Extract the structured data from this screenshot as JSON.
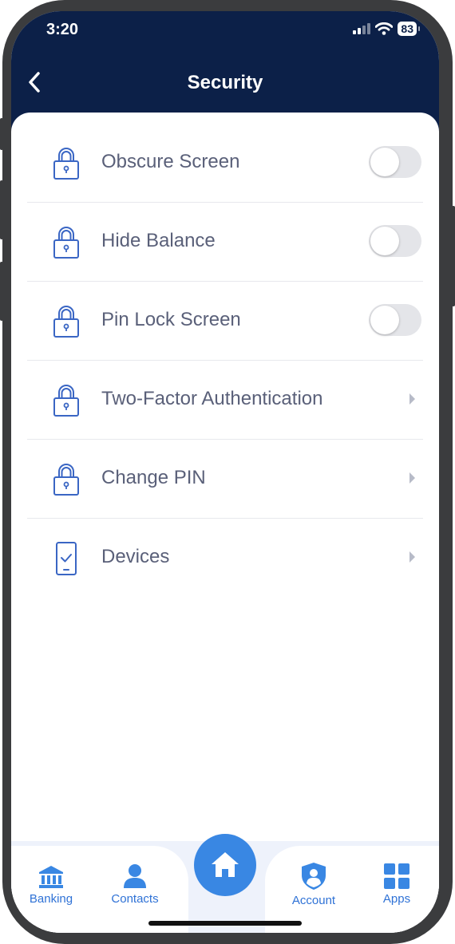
{
  "status_bar": {
    "time": "3:20",
    "battery": "83"
  },
  "header": {
    "title": "Security"
  },
  "settings": [
    {
      "label": "Obscure Screen",
      "icon": "lock-icon",
      "control": "toggle",
      "enabled": false
    },
    {
      "label": "Hide Balance",
      "icon": "lock-icon",
      "control": "toggle",
      "enabled": false
    },
    {
      "label": "Pin Lock Screen",
      "icon": "lock-icon",
      "control": "toggle",
      "enabled": false
    },
    {
      "label": "Two-Factor Authentication",
      "icon": "lock-icon",
      "control": "chevron"
    },
    {
      "label": "Change PIN",
      "icon": "lock-icon",
      "control": "chevron"
    },
    {
      "label": "Devices",
      "icon": "phone-icon",
      "control": "chevron"
    }
  ],
  "tabbar": {
    "items": [
      {
        "label": "Banking",
        "icon": "bank-icon"
      },
      {
        "label": "Contacts",
        "icon": "person-icon"
      },
      {
        "label": "Home",
        "icon": "home-icon"
      },
      {
        "label": "Account",
        "icon": "shield-user-icon"
      },
      {
        "label": "Apps",
        "icon": "grid-icon"
      }
    ]
  },
  "colors": {
    "header_bg": "#0c2048",
    "accent": "#3987e3",
    "icon": "#3a66c4",
    "label": "#5a6079",
    "toggle_off": "#e4e5e9"
  }
}
